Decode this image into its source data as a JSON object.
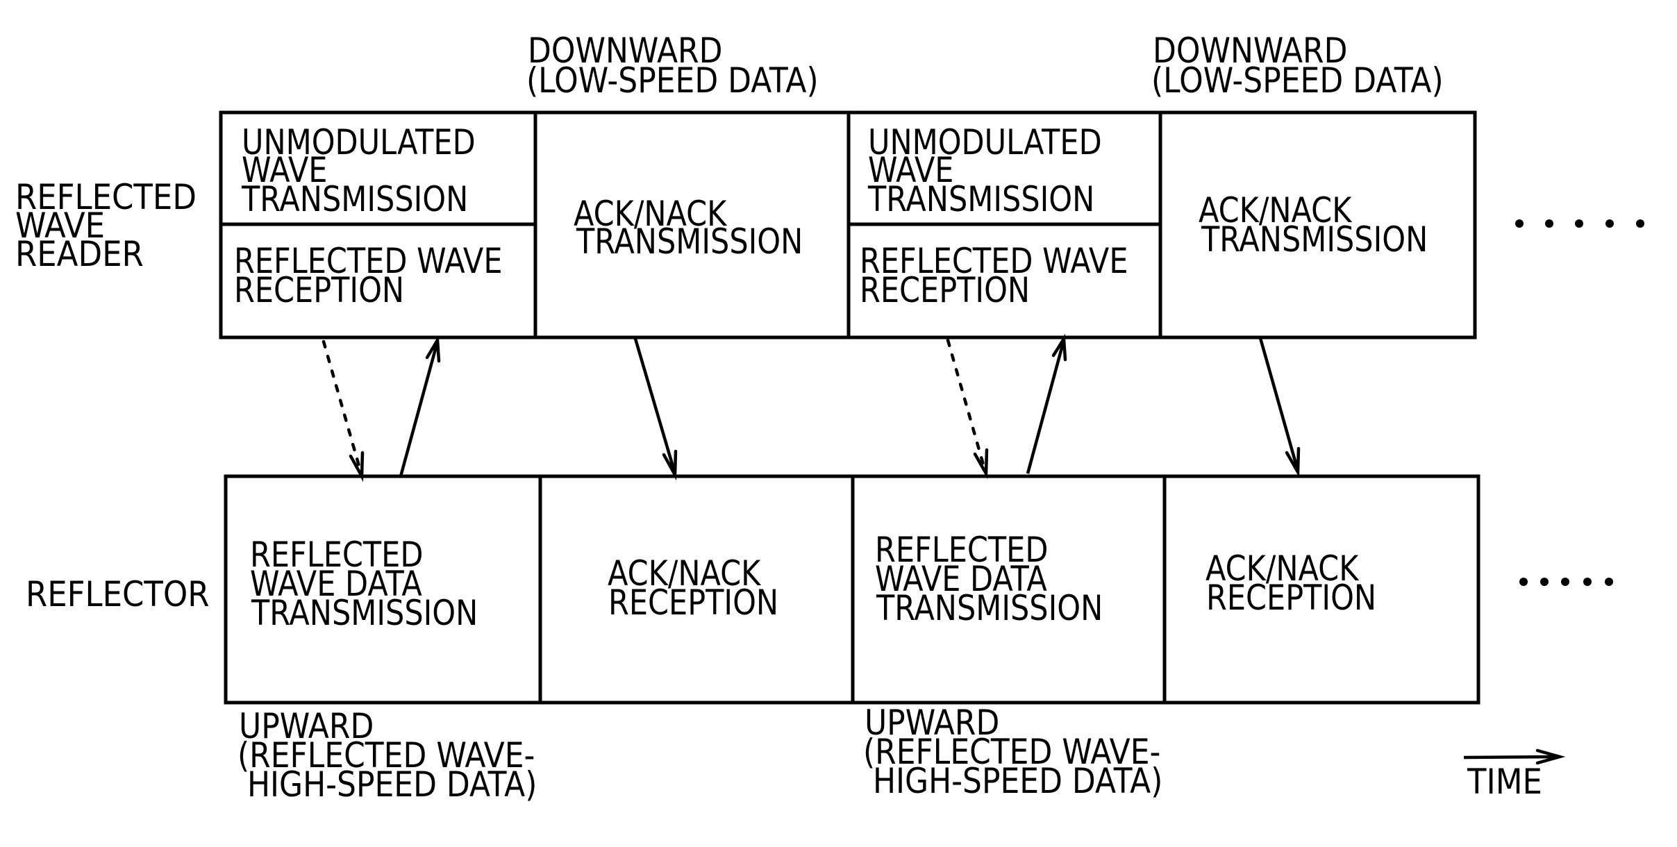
{
  "diagram": {
    "type": "timing-sequence",
    "rows": {
      "reader": {
        "label_lines": [
          "REFLECTED",
          "WAVE",
          "READER"
        ],
        "cells": [
          {
            "top_lines": [
              "UNMODULATED",
              "WAVE",
              "TRANSMISSION"
            ],
            "bottom_lines": [
              "REFLECTED WAVE",
              "RECEPTION"
            ]
          },
          {
            "lines": [
              "ACK/NACK",
              "TRANSMISSION"
            ]
          },
          {
            "top_lines": [
              "UNMODULATED",
              "WAVE",
              "TRANSMISSION"
            ],
            "bottom_lines": [
              "REFLECTED WAVE",
              "RECEPTION"
            ]
          },
          {
            "lines": [
              "ACK/NACK",
              "TRANSMISSION"
            ]
          }
        ],
        "continuation": "....."
      },
      "reflector": {
        "label_lines": [
          "REFLECTOR"
        ],
        "cells": [
          {
            "lines": [
              "REFLECTED",
              "WAVE DATA",
              "TRANSMISSION"
            ]
          },
          {
            "lines": [
              "ACK/NACK",
              "RECEPTION"
            ]
          },
          {
            "lines": [
              "REFLECTED",
              "WAVE DATA",
              "TRANSMISSION"
            ]
          },
          {
            "lines": [
              "ACK/NACK",
              "RECEPTION"
            ]
          }
        ],
        "continuation": "....."
      }
    },
    "annotations": {
      "downward": [
        [
          "DOWNWARD",
          "(LOW-SPEED DATA)"
        ],
        [
          "DOWNWARD",
          "(LOW-SPEED DATA)"
        ]
      ],
      "upward": [
        [
          "UPWARD",
          "(REFLECTED WAVE-",
          " HIGH-SPEED DATA)"
        ],
        [
          "UPWARD",
          "(REFLECTED WAVE-",
          " HIGH-SPEED DATA)"
        ]
      ],
      "time_label": "TIME"
    },
    "arrows": [
      {
        "from": "reader.cell0",
        "to": "reflector.cell0",
        "style": "dashed",
        "meaning": "unmodulated wave"
      },
      {
        "from": "reflector.cell0",
        "to": "reader.cell0",
        "style": "solid",
        "meaning": "reflected wave data"
      },
      {
        "from": "reader.cell1",
        "to": "reflector.cell1",
        "style": "solid",
        "meaning": "ACK/NACK"
      },
      {
        "from": "reader.cell2",
        "to": "reflector.cell2",
        "style": "dashed",
        "meaning": "unmodulated wave"
      },
      {
        "from": "reflector.cell2",
        "to": "reader.cell2",
        "style": "solid",
        "meaning": "reflected wave data"
      },
      {
        "from": "reader.cell3",
        "to": "reflector.cell3",
        "style": "solid",
        "meaning": "ACK/NACK"
      }
    ]
  }
}
